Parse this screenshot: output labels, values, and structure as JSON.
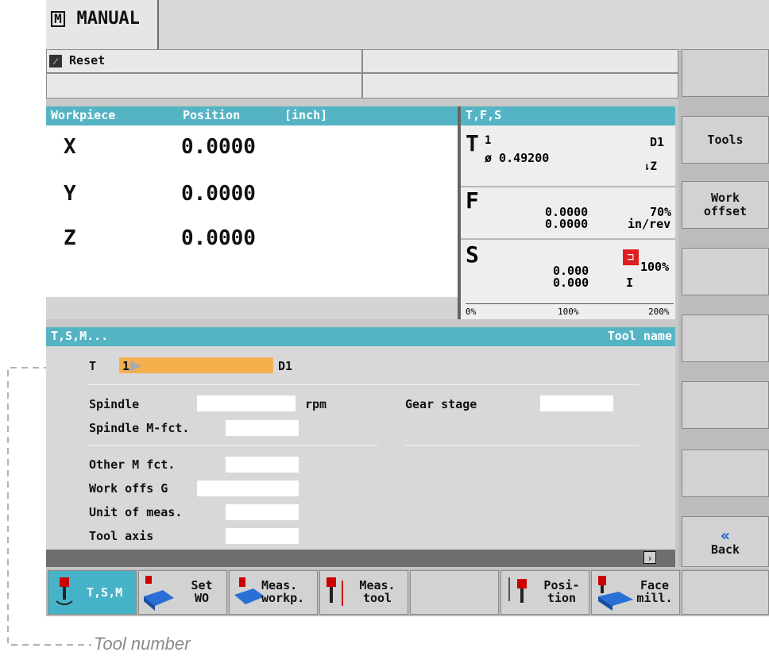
{
  "mode": "MANUAL",
  "status": {
    "reset_label": "Reset"
  },
  "workpiece": {
    "col1": "Workpiece",
    "col2": "Position",
    "unit": "[inch]",
    "axes": [
      {
        "name": "X",
        "value": "0.0000"
      },
      {
        "name": "Y",
        "value": "0.0000"
      },
      {
        "name": "Z",
        "value": "0.0000"
      }
    ]
  },
  "tfs": {
    "title": "T,F,S",
    "t_letter": "T",
    "tool_number": "1",
    "diameter": "ø 0.49200",
    "d_number": "D1",
    "axis_label": "Z",
    "f_letter": "F",
    "feed_1": "0.0000",
    "feed_2": "0.0000",
    "feed_override": "70%",
    "feed_unit": "in/rev",
    "s_letter": "S",
    "speed_1": "0.000",
    "speed_2": "0.000",
    "spindle_override": "100%",
    "gear": "I",
    "scale": [
      "0%",
      "100%",
      "200%"
    ]
  },
  "tsm": {
    "title": "T,S,M...",
    "right_title": "Tool name",
    "t_label": "T",
    "t_value": "1",
    "d_label": "D1",
    "spindle_label": "Spindle",
    "rpm_label": "rpm",
    "gear_stage_label": "Gear stage",
    "spindle_mfct_label": "Spindle M-fct.",
    "other_m_label": "Other M fct.",
    "work_offs_label": "Work offs G",
    "unit_meas_label": "Unit of meas.",
    "tool_axis_label": "Tool axis"
  },
  "vsoftkeys": [
    "",
    "Tools",
    "Work offset",
    "",
    "",
    "",
    "",
    "Back"
  ],
  "back_chevron": "«",
  "hsoftkeys": [
    {
      "label": "T,S,M",
      "icon": "tool-spindle-icon"
    },
    {
      "label": "Set WO",
      "icon": "set-wo-icon"
    },
    {
      "label": "Meas. workp.",
      "icon": "measure-workpiece-icon"
    },
    {
      "label": "Meas. tool",
      "icon": "measure-tool-icon"
    },
    {
      "label": "",
      "icon": ""
    },
    {
      "label": "Posi- tion",
      "icon": "position-icon"
    },
    {
      "label": "Face mill.",
      "icon": "face-mill-icon"
    },
    {
      "label": "",
      "icon": ""
    }
  ],
  "expand_icon": "chevron-right-icon",
  "callout": {
    "text": "Tool number"
  }
}
